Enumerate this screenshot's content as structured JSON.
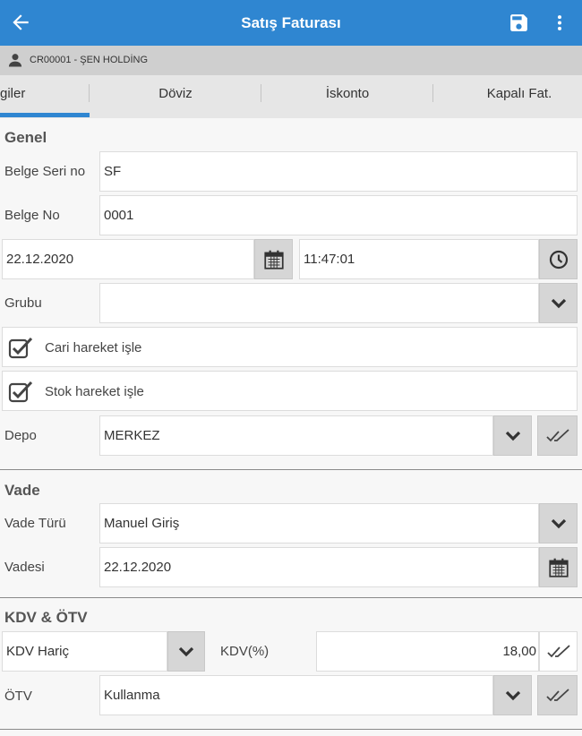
{
  "header": {
    "title": "Satış Faturası",
    "back_icon": "arrow-left-icon",
    "save_icon": "floppy-disk-icon",
    "menu_icon": "more-vert-icon",
    "color": "#2f86d1"
  },
  "customer": {
    "icon": "person-icon",
    "text": "CR00001 - ŞEN HOLDİNG"
  },
  "tabs": [
    {
      "label": "giler",
      "active": true
    },
    {
      "label": "Döviz",
      "active": false
    },
    {
      "label": "İskonto",
      "active": false
    },
    {
      "label": "Kapalı Fat.",
      "active": false
    }
  ],
  "genel": {
    "title": "Genel",
    "belge_seri_label": "Belge Seri no",
    "belge_seri_value": "SF",
    "belge_no_label": "Belge No",
    "belge_no_value": "0001",
    "date_value": "22.12.2020",
    "time_value": "11:47:01",
    "grubu_label": "Grubu",
    "grubu_value": "",
    "cari_label": "Cari hareket işle",
    "cari_checked": true,
    "stok_label": "Stok hareket işle",
    "stok_checked": true,
    "depo_label": "Depo",
    "depo_value": "MERKEZ"
  },
  "vade": {
    "title": "Vade",
    "vade_turu_label": "Vade Türü",
    "vade_turu_value": "Manuel Giriş",
    "vadesi_label": "Vadesi",
    "vadesi_value": "22.12.2020"
  },
  "kdv": {
    "title": "KDV & ÖTV",
    "kdv_type_value": "KDV Hariç",
    "kdv_percent_label": "KDV(%)",
    "kdv_percent_value": "18,00",
    "otv_label": "ÖTV",
    "otv_value": "Kullanma"
  }
}
